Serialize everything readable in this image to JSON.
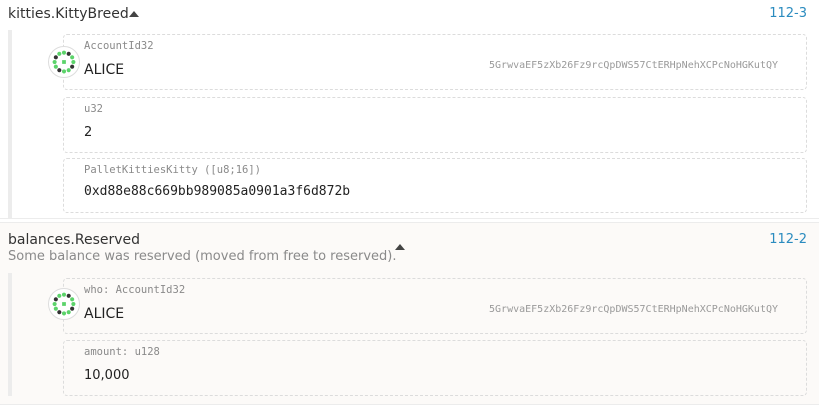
{
  "events": [
    {
      "title": "kitties.KittyBreed",
      "index": "112-3",
      "fields": [
        {
          "label": "AccountId32",
          "value": "ALICE",
          "address": "5GrwvaEF5zXb26Fz9rcQpDWS57CtERHpNehXCPcNoHGKutQY"
        },
        {
          "label": "u32",
          "value": "2"
        },
        {
          "label": "PalletKittiesKitty ([u8;16])",
          "value": "0xd88e88c669bb989085a0901a3f6d872b"
        }
      ]
    },
    {
      "title": "balances.Reserved",
      "description": "Some balance was reserved (moved from free to reserved).",
      "index": "112-2",
      "fields": [
        {
          "label": "who: AccountId32",
          "value": "ALICE",
          "address": "5GrwvaEF5zXb26Fz9rcQpDWS57CtERHpNehXCPcNoHGKutQY"
        },
        {
          "label": "amount: u128",
          "value": "10,000"
        }
      ]
    }
  ],
  "colors": {
    "index_link": "#2a8bbf",
    "identicon_dot": "#5bd36a"
  },
  "icons": {
    "expand": "caret-up-icon",
    "identity": "identicon"
  }
}
